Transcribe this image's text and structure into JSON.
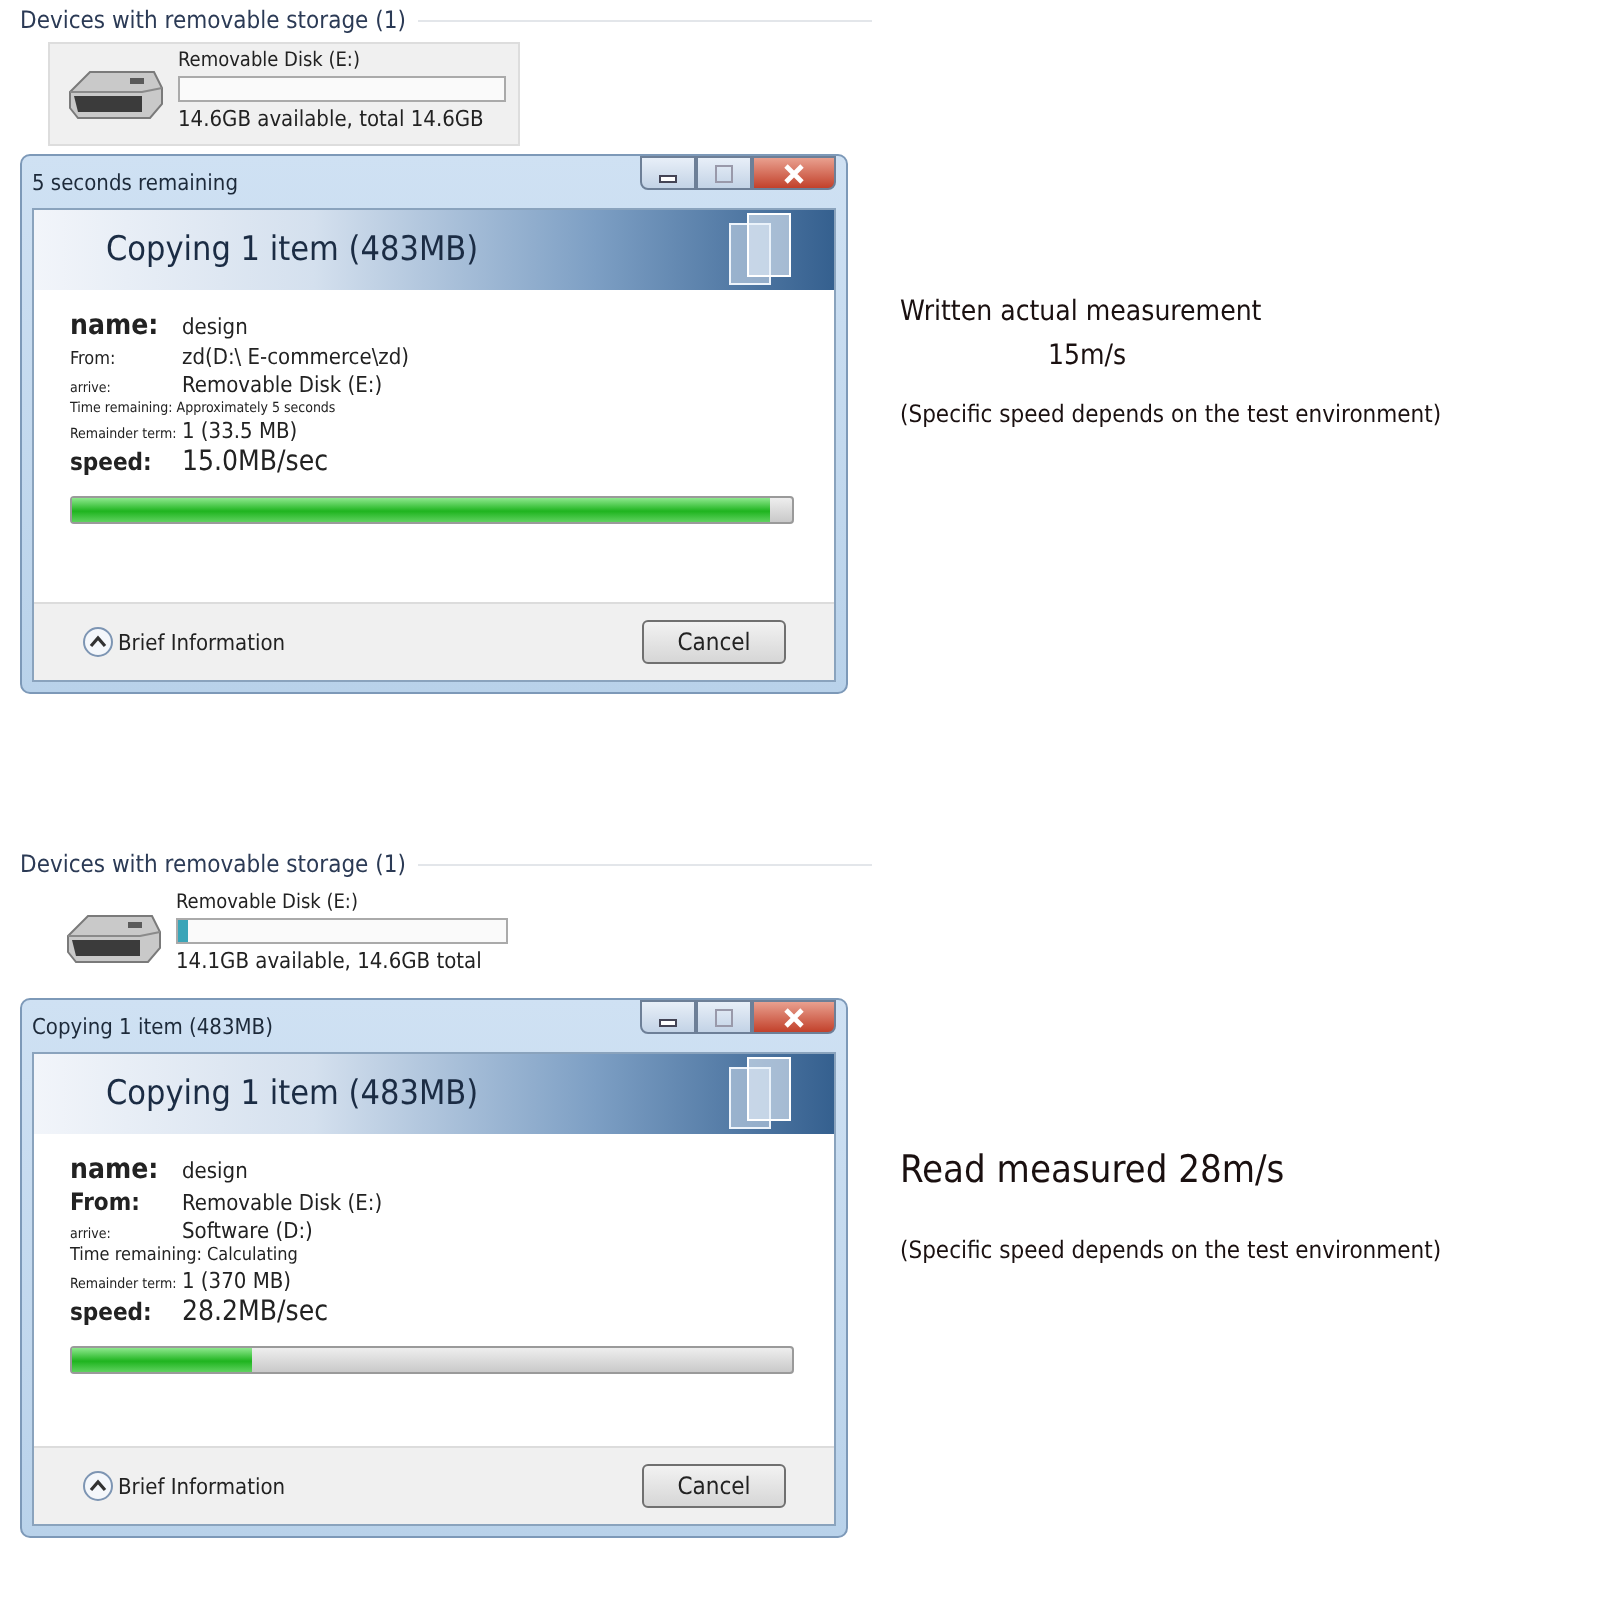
{
  "panels": [
    {
      "section_title": "Devices with removable storage (1)",
      "drive": {
        "name": "Removable Disk (E:)",
        "level": 0,
        "caption": "14.6GB available, total 14.6GB",
        "highlighted": true
      },
      "dialog": {
        "title": "5 seconds remaining",
        "heading": "Copying 1 item (483MB)",
        "rows": [
          {
            "kind": "name",
            "label": "name:",
            "value": "design"
          },
          {
            "kind": "detail",
            "label": "From:",
            "value": "zd(D:\\ E-commerce\\zd)"
          },
          {
            "kind": "fine",
            "label": "arrive:",
            "value": "Removable Disk (E:)"
          },
          {
            "kind": "note",
            "label": "Time remaining: Approximately 5 seconds"
          },
          {
            "kind": "fine",
            "label": "Remainder term:",
            "value": "1 (33.5 MB)"
          },
          {
            "kind": "speed",
            "label": "speed:",
            "value": "15.0MB/sec"
          }
        ],
        "level": 0.97,
        "details_label": "Brief Information",
        "cancel": "Cancel"
      },
      "notes": [
        {
          "kind": "headline",
          "text": "Written actual measurement"
        },
        {
          "kind": "figure",
          "text": "15m/s"
        },
        {
          "kind": "footnote",
          "text": "(Specific speed depends on the test environment)"
        }
      ]
    },
    {
      "section_title": "Devices with removable storage (1)",
      "drive": {
        "name": "Removable Disk (E:)",
        "level": 0.03,
        "caption": "14.1GB available, 14.6GB total",
        "highlighted": false
      },
      "dialog": {
        "title": "Copying 1 item (483MB)",
        "heading": "Copying 1 item (483MB)",
        "rows": [
          {
            "kind": "name",
            "label": "name:",
            "value": "design"
          },
          {
            "kind": "bold",
            "label": "From:",
            "value": "Removable Disk (E:)"
          },
          {
            "kind": "fine",
            "label": "arrive:",
            "value": "Software (D:)"
          },
          {
            "kind": "status",
            "label": "Time remaining: Calculating"
          },
          {
            "kind": "fine",
            "label": "Remainder term:",
            "value": "1 (370 MB)"
          },
          {
            "kind": "speed",
            "label": "speed:",
            "value": "28.2MB/sec"
          }
        ],
        "level": 0.25,
        "details_label": "Brief Information",
        "cancel": "Cancel"
      },
      "notes": [
        {
          "kind": "large",
          "text": "Read measured 28m/s"
        },
        {
          "kind": "footnote",
          "text": "(Specific speed depends on the test environment)"
        }
      ]
    }
  ]
}
